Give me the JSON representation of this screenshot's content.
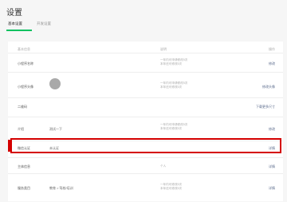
{
  "page": {
    "title": "设置"
  },
  "tabs": [
    {
      "label": "基本设置",
      "active": true
    },
    {
      "label": "开发设置",
      "active": false
    }
  ],
  "table": {
    "headers": {
      "item": "基本信息",
      "description": "说明",
      "action": "操作"
    },
    "rows": [
      {
        "label": "小程序名称",
        "value": "",
        "note": [
          "一年内可申请修改5次",
          "本年还可修改5次"
        ],
        "action": "修改"
      },
      {
        "label": "小程序头像",
        "value": "",
        "avatar": true,
        "note": [
          "一年内可申请修改5次",
          "本年还可修改5次"
        ],
        "action": "修改头像"
      },
      {
        "label": "二维码",
        "value": "",
        "note": [],
        "action": "下载更多尺寸"
      },
      {
        "label": "介绍",
        "value": "测试一下",
        "note": [
          "一年内可申请修改5次",
          "本年还可修改5次"
        ],
        "action": "修改"
      },
      {
        "label": "微信认证",
        "value": "未认证",
        "note": [],
        "action": "详情",
        "highlighted": true
      },
      {
        "label": "主体信息",
        "value": "",
        "note": [
          "个人"
        ],
        "action": "详情"
      },
      {
        "label": "服务类目",
        "value": "教育 > 驾校/培训",
        "note": [
          "一年内可修改5次",
          "本年还可修改5次"
        ],
        "action": "详情"
      }
    ]
  },
  "colors": {
    "accent": "#07c160",
    "highlight": "#d40000"
  }
}
